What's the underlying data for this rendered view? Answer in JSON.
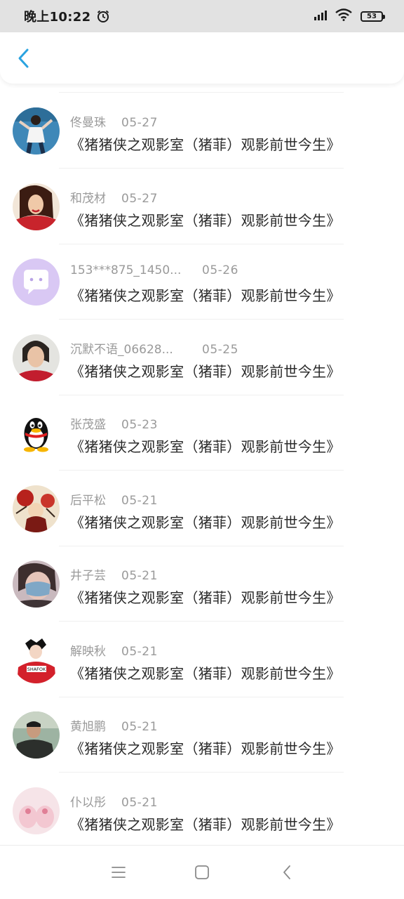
{
  "status_bar": {
    "time": "晚上10:22",
    "battery": "53",
    "icons": [
      "alarm-icon",
      "signal-icon",
      "wifi-icon",
      "battery-icon"
    ]
  },
  "header": {
    "back_icon": "chevron-left-icon",
    "accent_color": "#2aa3e0"
  },
  "items": [
    {
      "name": "佟曼珠",
      "date": "05-27",
      "title": "《猪猪侠之观影室（猪菲）观影前世今生》",
      "avatar": "photo-girl-blue"
    },
    {
      "name": "和茂材",
      "date": "05-27",
      "title": "《猪猪侠之观影室（猪菲）观影前世今生》",
      "avatar": "illustration-woman-red"
    },
    {
      "name": "153***875_1450...",
      "date": "05-26",
      "title": "《猪猪侠之观影室（猪菲）观影前世今生》",
      "avatar": "chat-bubble-purple"
    },
    {
      "name": "沉默不语_06628...",
      "date": "05-25",
      "title": "《猪猪侠之观影室（猪菲）观影前世今生》",
      "avatar": "photo-person"
    },
    {
      "name": "张茂盛",
      "date": "05-23",
      "title": "《猪猪侠之观影室（猪菲）观影前世今生》",
      "avatar": "qq-penguin"
    },
    {
      "name": "后平松",
      "date": "05-21",
      "title": "《猪猪侠之观影室（猪菲）观影前世今生》",
      "avatar": "illustration-floral"
    },
    {
      "name": "井子芸",
      "date": "05-21",
      "title": "《猪猪侠之观影室（猪菲）观影前世今生》",
      "avatar": "photo-mask"
    },
    {
      "name": "解映秋",
      "date": "05-21",
      "title": "《猪猪侠之观影室（猪菲）观影前世今生》",
      "avatar": "cartoon-red-shirt"
    },
    {
      "name": "黄旭鹏",
      "date": "05-21",
      "title": "《猪猪侠之观影室（猪菲）观影前世今生》",
      "avatar": "photo-man-green"
    },
    {
      "name": "仆以彤",
      "date": "05-21",
      "title": "《猪猪侠之观影室（猪菲）观影前世今生》",
      "avatar": "photo-pink-slippers"
    }
  ],
  "nav_bar": {
    "icons": [
      "menu-icon",
      "home-square-icon",
      "back-triangle-icon"
    ]
  }
}
